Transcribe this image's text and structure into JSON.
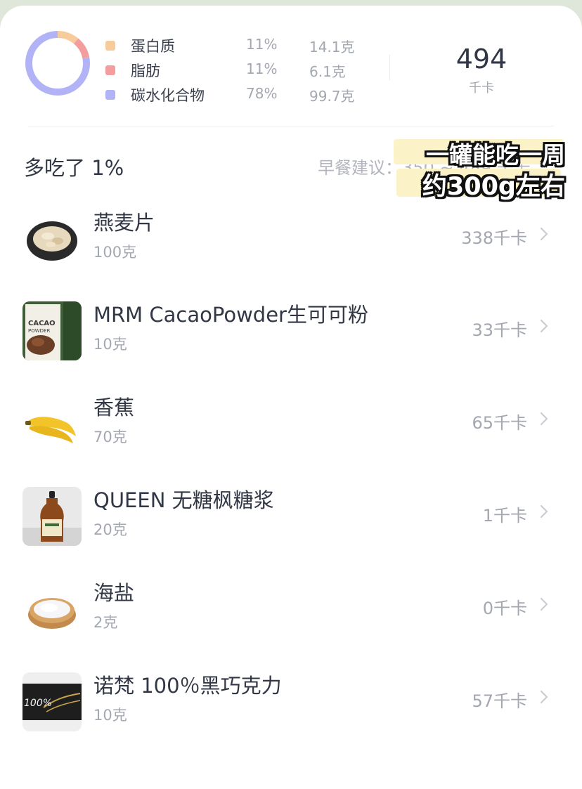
{
  "summary": {
    "macros": [
      {
        "name": "蛋白质",
        "pct": "11%",
        "amount": "14.1克",
        "color": "#f8cb9c",
        "value": 11
      },
      {
        "name": "脂肪",
        "pct": "11%",
        "amount": "6.1克",
        "color": "#f49d9f",
        "value": 11
      },
      {
        "name": "碳水化合物",
        "pct": "78%",
        "amount": "99.7克",
        "color": "#b2b3f6",
        "value": 78
      }
    ],
    "kcal": "494",
    "kcal_unit": "千卡"
  },
  "status": {
    "over_text": "多吃了 1%",
    "suggest_text": "早餐建议：350 ~ 489 千卡"
  },
  "overlay": {
    "line1": "一罐能吃一周",
    "line2": "约300g左右"
  },
  "foods": [
    {
      "name": "燕麦片",
      "amount": "100克",
      "kcal": "338千卡",
      "icon": "oats-image"
    },
    {
      "name": "MRM CacaoPowder生可可粉",
      "amount": "10克",
      "kcal": "33千卡",
      "icon": "cacao-powder-image"
    },
    {
      "name": "香蕉",
      "amount": "70克",
      "kcal": "65千卡",
      "icon": "banana-image"
    },
    {
      "name": "QUEEN 无糖枫糖浆",
      "amount": "20克",
      "kcal": "1千卡",
      "icon": "maple-syrup-image"
    },
    {
      "name": "海盐",
      "amount": "2克",
      "kcal": "0千卡",
      "icon": "sea-salt-image"
    },
    {
      "name": "诺梵 100％黑巧克力",
      "amount": "10克",
      "kcal": "57千卡",
      "icon": "dark-chocolate-image"
    }
  ],
  "thumb_text": {
    "cacao_label": "CACAO",
    "cacao_sub": "POWDER",
    "choc_label": "100%"
  }
}
